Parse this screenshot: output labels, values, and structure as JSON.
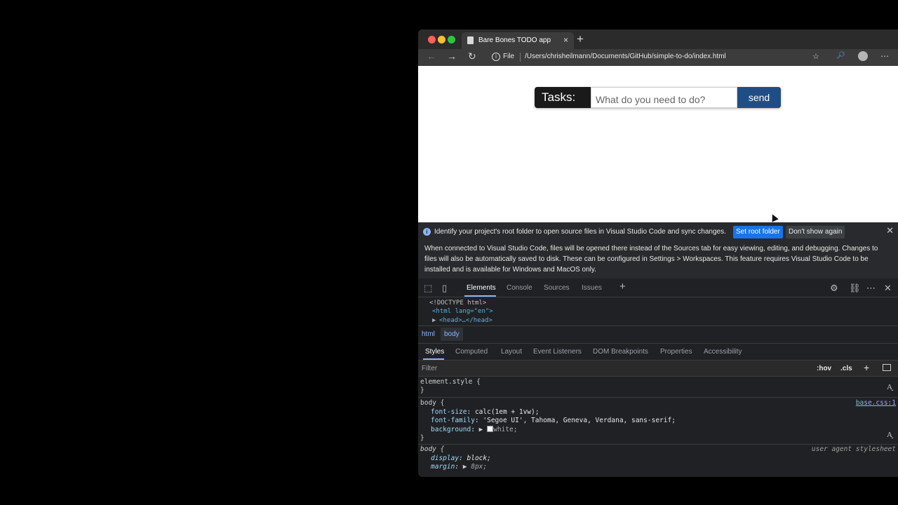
{
  "browser": {
    "tab_title": "Bare Bones TODO app",
    "tab_close": "×",
    "new_tab": "+",
    "protocol": "File",
    "url": "/Users/chrisheilmann/Documents/GitHub/simple-to-do/index.html",
    "icons": [
      "back-icon",
      "forward-icon",
      "reload-icon",
      "info-icon",
      "favorites-icon",
      "extension-icon",
      "profile-icon",
      "more-icon"
    ]
  },
  "app": {
    "label": "Tasks:",
    "input_placeholder": "What do you need to do?",
    "send_label": "send",
    "accent": "#1f4e86"
  },
  "devtools": {
    "banner": {
      "message": "Identify your project's root folder to open source files in Visual Studio Code and sync changes.",
      "set_root": "Set root folder",
      "dont_show": "Don't show again",
      "details": "When connected to Visual Studio Code, files will be opened there instead of the Sources tab for easy viewing, editing, and debugging. Changes to files will also be automatically saved to disk. These can be configured in Settings > Workspaces. This feature requires Visual Studio Code to be installed and is available for Windows and MacOS only."
    },
    "tabs": [
      "Elements",
      "Console",
      "Sources",
      "Issues"
    ],
    "dom": [
      "<!DOCTYPE html>",
      "<html lang=\"en\">",
      "<head>…</head>"
    ],
    "breadcrumbs": [
      "html",
      "body"
    ],
    "subtabs": [
      "Styles",
      "Computed",
      "Layout",
      "Event Listeners",
      "DOM Breakpoints",
      "Properties",
      "Accessibility"
    ],
    "filter_placeholder": "Filter",
    "hov": ":hov",
    "cls": ".cls",
    "styles": {
      "element_style": "element.style {",
      "close": "}",
      "body_rule": "body {",
      "source": "base.css:1",
      "p1_name": "font-size",
      "p1_val": "calc(1em + 1vw);",
      "p2_name": "font-family",
      "p2_val": "'Segoe UI', Tahoma, Geneva, Verdana, sans-serif;",
      "p3_name": "background",
      "p3_val": "white;",
      "ua_rule": "body {",
      "ua_label": "user agent stylesheet",
      "p4_name": "display",
      "p4_val": "block;",
      "p5_name": "margin",
      "p5_val": "8px;"
    }
  }
}
